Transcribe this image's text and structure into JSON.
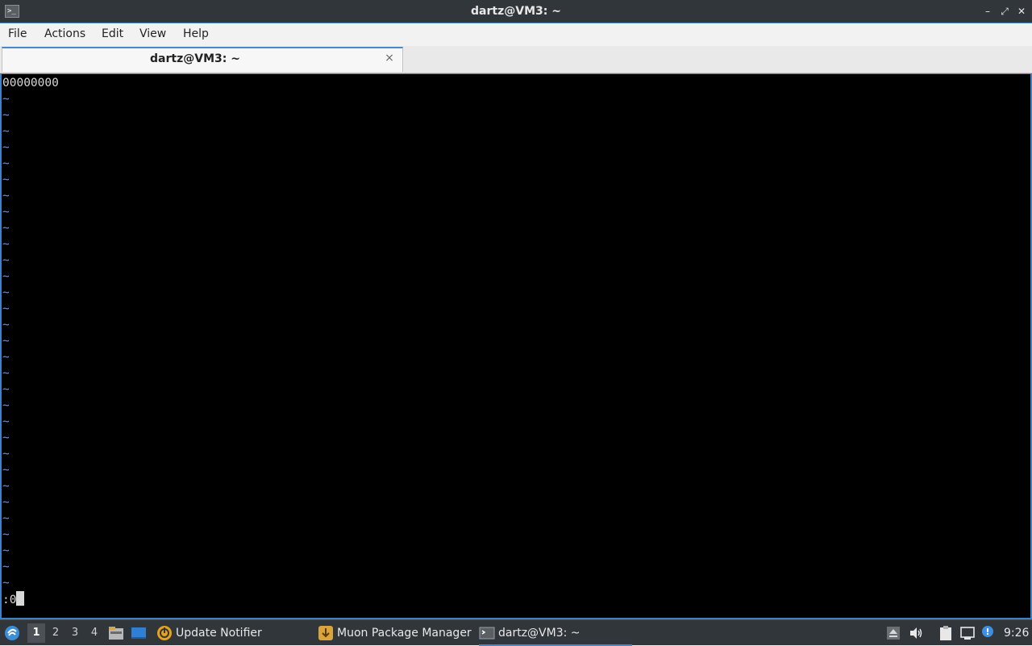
{
  "window": {
    "title": "dartz@VM3: ~",
    "app_icon_text": ">_",
    "controls": {
      "minimize": "–",
      "maximize": "⤢",
      "close": "✕"
    }
  },
  "menu": {
    "file": "File",
    "actions": "Actions",
    "edit": "Edit",
    "view": "View",
    "help": "Help"
  },
  "tabs": [
    {
      "label": "dartz@VM3: ~",
      "close": "×"
    }
  ],
  "terminal": {
    "first_line": "00000000",
    "tilde": "~",
    "tilde_count": 31,
    "command_line": ":0"
  },
  "taskbar": {
    "desktops": [
      "1",
      "2",
      "3",
      "4"
    ],
    "active_desktop": "1",
    "tasks": [
      {
        "label": "Update Notifier",
        "icon": "update-notifier-icon"
      },
      {
        "label": "Muon Package Manager",
        "icon": "muon-package-icon"
      },
      {
        "label": "dartz@VM3: ~",
        "icon": "terminal-icon"
      }
    ],
    "clock": "9:26"
  },
  "colors": {
    "accent": "#4a88c8",
    "titlebar": "#31363b",
    "terminal_bg": "#000000",
    "terminal_fg": "#d8d8d8",
    "tilde": "#6c8fd0"
  }
}
